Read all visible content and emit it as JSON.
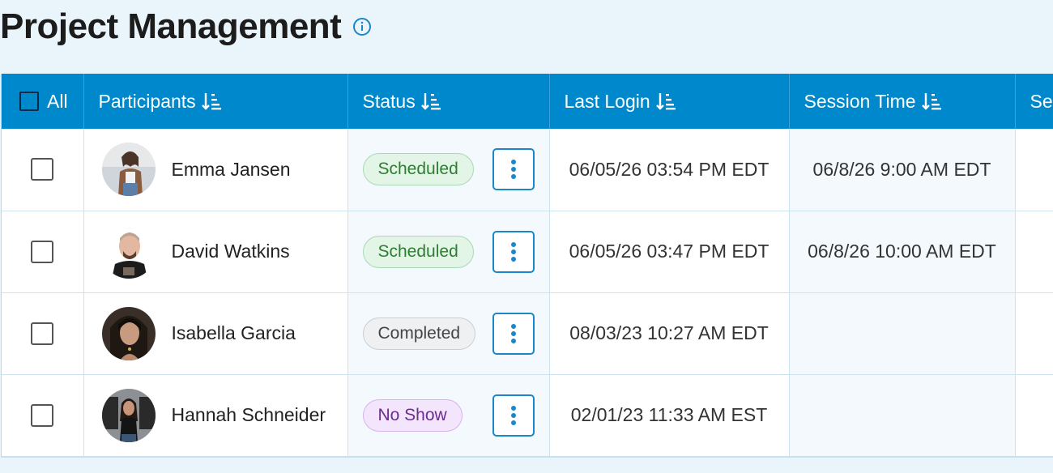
{
  "page": {
    "title": "Project Management",
    "info_icon": "info-circle-icon"
  },
  "table": {
    "headers": {
      "all": "All",
      "participants": "Participants",
      "status": "Status",
      "last_login": "Last Login",
      "session_time": "Session Time",
      "partial": "Se"
    },
    "rows": [
      {
        "name": "Emma Jansen",
        "status": "Scheduled",
        "last_login": "06/05/26 03:54 PM EDT",
        "session_time": "06/8/26 9:00 AM EDT"
      },
      {
        "name": "David Watkins",
        "status": "Scheduled",
        "last_login": "06/05/26 03:47 PM EDT",
        "session_time": "06/8/26 10:00 AM EDT"
      },
      {
        "name": "Isabella Garcia",
        "status": "Completed",
        "last_login": "08/03/23 10:27 AM EDT",
        "session_time": ""
      },
      {
        "name": "Hannah Schneider",
        "status": "No Show",
        "last_login": "02/01/23 11:33 AM EST",
        "session_time": ""
      }
    ]
  },
  "colors": {
    "header_bg": "#0088cc",
    "page_bg": "#eaf4fb",
    "scheduled": "#2e7d32",
    "completed": "#444444",
    "no_show": "#6a2c91"
  }
}
